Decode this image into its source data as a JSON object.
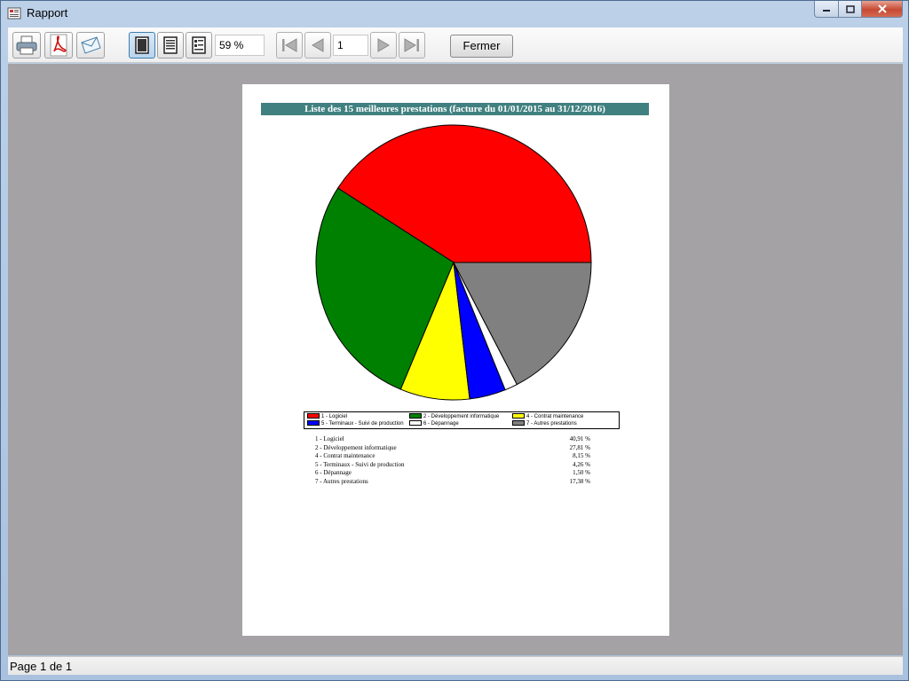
{
  "window": {
    "title": "Rapport"
  },
  "toolbar": {
    "zoom_value": "59  %",
    "page_value": "1",
    "close_label": "Fermer"
  },
  "report": {
    "title": "Liste des 15 meilleures prestations (facture du 01/01/2015 au 31/12/2016)"
  },
  "chart_data": {
    "type": "pie",
    "slices": [
      {
        "label": "1 - Logiciel",
        "value": 40.91,
        "value_text": "40,91 %",
        "color": "#ff0000"
      },
      {
        "label": "2 - Développement informatique",
        "value": 27.81,
        "value_text": "27,81 %",
        "color": "#008000"
      },
      {
        "label": "4 - Contrat maintenance",
        "value": 8.15,
        "value_text": "8,15 %",
        "color": "#ffff00"
      },
      {
        "label": "5 - Terminaux - Suivi de production",
        "value": 4.26,
        "value_text": "4,26 %",
        "color": "#0000ff"
      },
      {
        "label": "6 - Dépannage",
        "value": 1.5,
        "value_text": "1,50 %",
        "color": "#ffffff"
      },
      {
        "label": "7 - Autres prestations",
        "value": 17.38,
        "value_text": "17,38 %",
        "color": "#808080"
      }
    ],
    "start_angle_deg": 0,
    "direction": "counterclockwise"
  },
  "status": {
    "text": "Page 1 de 1"
  },
  "colors": {
    "title_bar": "#408080",
    "preview_bg": "#a4a2a4"
  }
}
